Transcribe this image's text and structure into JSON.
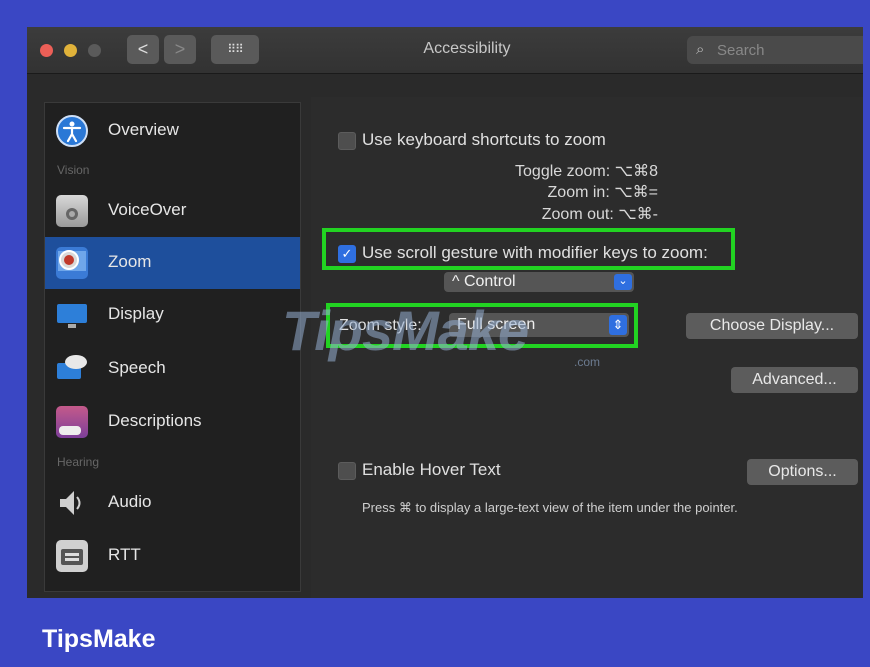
{
  "window": {
    "title": "Accessibility",
    "search_placeholder": "Search",
    "nav_back_glyph": "<",
    "nav_forward_glyph": ">",
    "grid_glyph": "⠿⠿"
  },
  "sidebar": {
    "section_vision": "Vision",
    "section_hearing": "Hearing",
    "items": [
      {
        "label": "Overview",
        "icon": "accessibility-icon"
      },
      {
        "label": "VoiceOver",
        "icon": "voiceover-icon"
      },
      {
        "label": "Zoom",
        "icon": "zoom-icon",
        "selected": true
      },
      {
        "label": "Display",
        "icon": "display-icon"
      },
      {
        "label": "Speech",
        "icon": "speech-icon"
      },
      {
        "label": "Descriptions",
        "icon": "descriptions-icon"
      },
      {
        "label": "Audio",
        "icon": "audio-icon"
      },
      {
        "label": "RTT",
        "icon": "rtt-icon"
      }
    ]
  },
  "zoom": {
    "keyboard_shortcuts_label": "Use keyboard shortcuts to zoom",
    "keyboard_shortcuts_checked": false,
    "toggle_zoom_label": "Toggle zoom:",
    "toggle_zoom_keys": "⌥⌘8",
    "zoom_in_label": "Zoom in:",
    "zoom_in_keys": "⌥⌘=",
    "zoom_out_label": "Zoom out:",
    "zoom_out_keys": "⌥⌘-",
    "scroll_gesture_label": "Use scroll gesture with modifier keys to zoom:",
    "scroll_gesture_checked": true,
    "modifier_value": "^ Control",
    "zoom_style_label": "Zoom style:",
    "zoom_style_value": "Full screen",
    "choose_display_button": "Choose Display...",
    "advanced_button": "Advanced...",
    "hover_text_label": "Enable Hover Text",
    "hover_text_checked": false,
    "options_button": "Options...",
    "hover_hint": "Press ⌘ to display a large-text view of the item under the pointer."
  },
  "watermark": {
    "text": "TipsMake",
    "suffix": ".com"
  },
  "brand": "TipsMake",
  "colors": {
    "frame_blue": "#3a47c4",
    "selection_blue": "#1e4f9c",
    "highlight_green": "#22d322",
    "checkbox_blue": "#2f6fe0"
  }
}
